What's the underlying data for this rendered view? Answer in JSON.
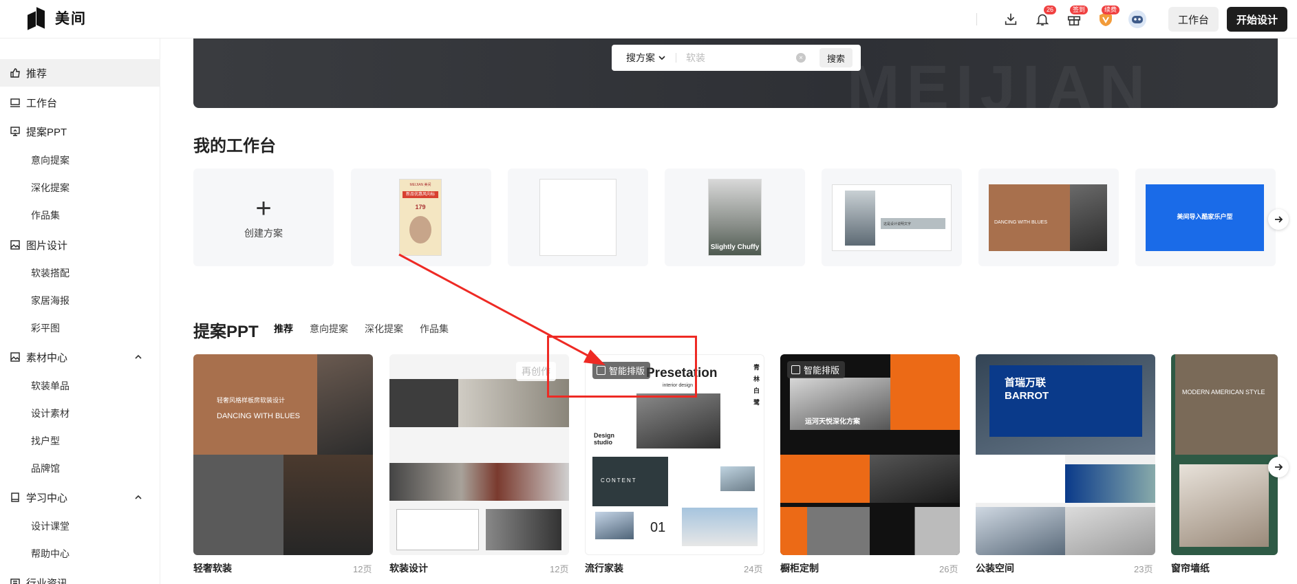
{
  "app": {
    "name": "美间"
  },
  "topbar": {
    "badges": {
      "notify": "26",
      "gift": "签到",
      "vip": "续费"
    },
    "workspace_btn": "工作台",
    "start_btn": "开始设计"
  },
  "sidebar": {
    "recommend": "推荐",
    "workspace": "工作台",
    "ppt": "提案PPT",
    "ppt_items": [
      "意向提案",
      "深化提案",
      "作品集"
    ],
    "image_design": "图片设计",
    "image_items": [
      "软装搭配",
      "家居海报",
      "彩平图"
    ],
    "material": "素材中心",
    "material_items": [
      "软装单品",
      "设计素材",
      "找户型",
      "品牌馆"
    ],
    "learning": "学习中心",
    "learning_items": [
      "设计课堂",
      "帮助中心"
    ],
    "industry": "行业资讯"
  },
  "search": {
    "type": "搜方案",
    "placeholder": "软装",
    "button": "搜索"
  },
  "my_workspace": {
    "title": "我的工作台",
    "create_label": "创建方案",
    "thumb_text": {
      "card1_head": "MEIJIAN 美间",
      "card1_banner": "新品优惠风向标",
      "card1_price": "179",
      "card3_text": "Slightly Chuffy",
      "card4_text": "这是设计说明文字",
      "card5_title": "DANCING WITH BLUES",
      "card6_title": "美间导入酷家乐户型"
    }
  },
  "ppt_section": {
    "title": "提案PPT",
    "tabs": [
      "推荐",
      "意向提案",
      "深化提案",
      "作品集"
    ],
    "smart_tag": "智能排版",
    "recreate_hint": "再创作",
    "cards": [
      {
        "name": "轻奢软装",
        "pages": "12页",
        "cover_title": "DANCING WITH BLUES",
        "cover_sub": "轻奢风格样板房软装设计"
      },
      {
        "name": "软装设计",
        "pages": "12页",
        "cover_title": ""
      },
      {
        "name": "流行家装",
        "pages": "24页",
        "cover_title": "Presetation",
        "cover_sub": "interior design",
        "side_text": "青林白鹭",
        "design_label": "Design studio",
        "content_label": "CONTENT",
        "num": "01"
      },
      {
        "name": "橱柜定制",
        "pages": "26页",
        "cover_title": "运河天悦深化方案"
      },
      {
        "name": "公装空间",
        "pages": "23页",
        "cover_title": "首瑞万联 BARROT"
      },
      {
        "name": "窗帘墙纸",
        "pages": "",
        "cover_title": "MODERN AMERICAN STYLE"
      }
    ]
  },
  "colors": {
    "annotation_red": "#ee2a24",
    "brand_dark": "#1e1e1e",
    "orange": "#ec6a16",
    "blue": "#0a3a8a"
  }
}
